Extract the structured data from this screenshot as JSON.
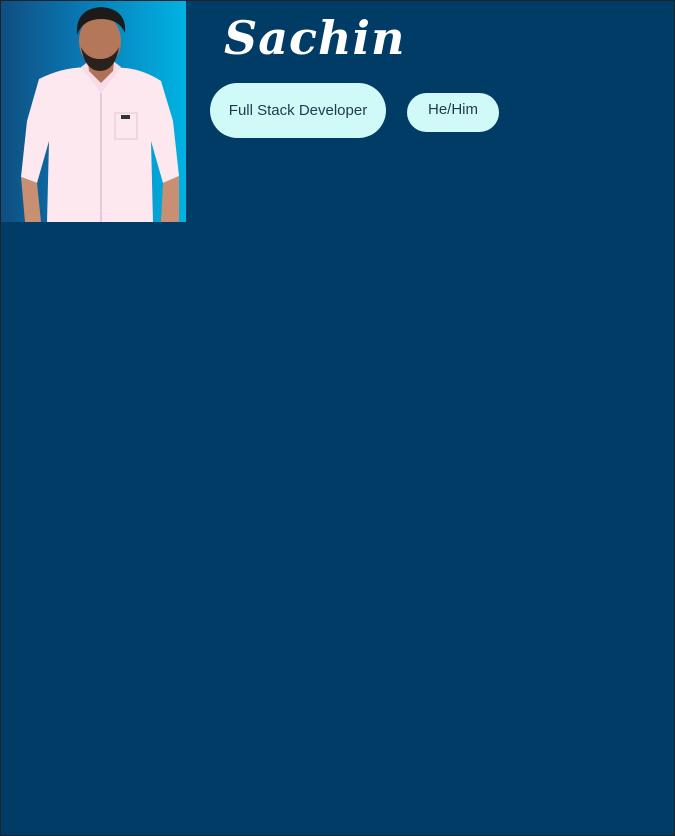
{
  "profile": {
    "name": "Sachin",
    "role": "Full Stack Developer",
    "pronouns": "He/Him",
    "photo_icon": "person-photo"
  },
  "colors": {
    "background": "#003c65",
    "pill": "#cffaf8",
    "pill_text": "#1f3a4f",
    "name_text": "#ffffff"
  }
}
